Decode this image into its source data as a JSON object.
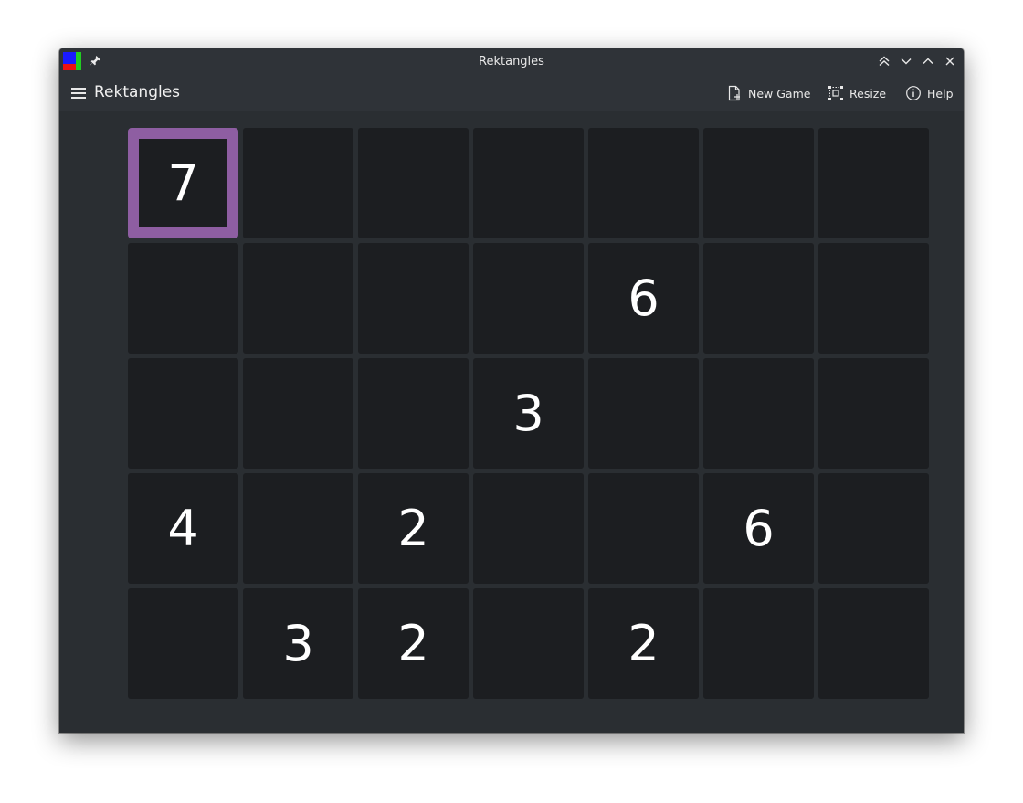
{
  "window": {
    "title": "Rektangles"
  },
  "toolbar": {
    "app_title": "Rektangles",
    "new_game_label": "New Game",
    "resize_label": "Resize",
    "help_label": "Help"
  },
  "board": {
    "rows": 5,
    "cols": 7,
    "selected_cell": [
      0,
      0
    ],
    "highlight_color": "#8e5ea2",
    "cells": [
      [
        "7",
        "",
        "",
        "",
        "",
        "",
        ""
      ],
      [
        "",
        "",
        "",
        "",
        "6",
        "",
        ""
      ],
      [
        "",
        "",
        "",
        "3",
        "",
        "",
        ""
      ],
      [
        "4",
        "",
        "2",
        "",
        "",
        "6",
        ""
      ],
      [
        "",
        "3",
        "2",
        "",
        "2",
        "",
        ""
      ]
    ]
  },
  "colors": {
    "window_bg": "#2a2e32",
    "titlebar_bg": "#2f3338",
    "cell_bg": "#1c1e21",
    "text": "#ffffff"
  }
}
